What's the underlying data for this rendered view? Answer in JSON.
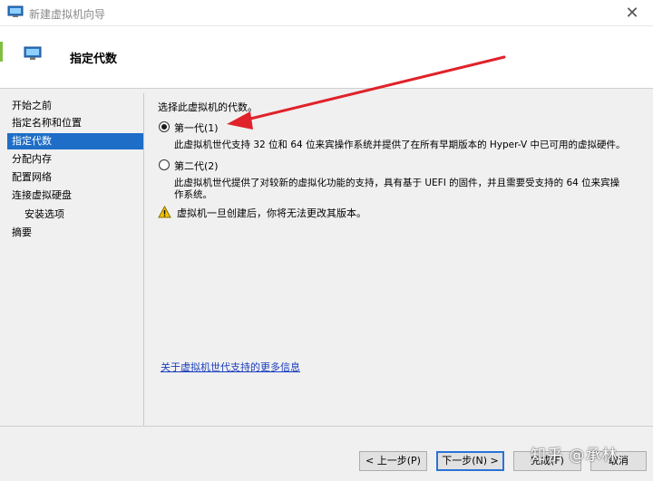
{
  "window": {
    "title": "新建虚拟机向导",
    "close_glyph": "✕"
  },
  "header": {
    "title": "指定代数"
  },
  "sidebar": {
    "items": [
      {
        "label": "开始之前"
      },
      {
        "label": "指定名称和位置"
      },
      {
        "label": "指定代数",
        "active": true
      },
      {
        "label": "分配内存"
      },
      {
        "label": "配置网络"
      },
      {
        "label": "连接虚拟硬盘"
      },
      {
        "label": "安装选项",
        "sub": true
      },
      {
        "label": "摘要"
      }
    ]
  },
  "content": {
    "prompt": "选择此虚拟机的代数。",
    "options": [
      {
        "label": "第一代(1)",
        "selected": true,
        "description": "此虚拟机世代支持 32 位和 64 位来宾操作系统并提供了在所有早期版本的 Hyper-V 中已可用的虚拟硬件。"
      },
      {
        "label": "第二代(2)",
        "selected": false,
        "description_line1": "此虚拟机世代提供了对较新的虚拟化功能的支持，具有基于 UEFI 的固件，并且需要受支持的 64 位来宾操",
        "description_line2": "作系统。"
      }
    ],
    "warning": "虚拟机一旦创建后，你将无法更改其版本。",
    "link": "关于虚拟机世代支持的更多信息"
  },
  "footer": {
    "prev": "< 上一步(P)",
    "next": "下一步(N) >",
    "finish": "完成(F)",
    "cancel": "取消"
  },
  "watermark": "知乎 @承林",
  "colors": {
    "accent": "#1e6ec8",
    "arrow": "#e0222a",
    "warning": "#f2c200",
    "link": "#1a3dbd"
  },
  "icons": {
    "window": "vm-window-icon",
    "warning": "warning-triangle-icon"
  }
}
